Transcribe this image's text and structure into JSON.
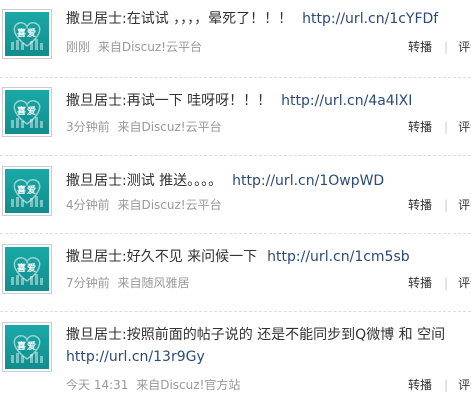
{
  "feed": {
    "posts": [
      {
        "avatar_text": "喜爱",
        "author": "撒旦居士:",
        "text": "在试试 ，，，，晕死了！！！",
        "link": "http://url.cn/1cYFDf",
        "time": "刚刚",
        "source": "来自Discuz!云平台",
        "repost_label": "转播",
        "comment_label": "评论"
      },
      {
        "avatar_text": "喜爱",
        "author": "撒旦居士:",
        "text": "再试一下 哇呀呀！！！",
        "link": "http://url.cn/4a4lXI",
        "time": "3分钟前",
        "source": "来自Discuz!云平台",
        "repost_label": "转播",
        "comment_label": "评论"
      },
      {
        "avatar_text": "喜爱",
        "author": "撒旦居士:",
        "text": "测试 推送。。。。",
        "link": "http://url.cn/1OwpWD",
        "time": "4分钟前",
        "source": "来自Discuz!云平台",
        "repost_label": "转播",
        "comment_label": "评论"
      },
      {
        "avatar_text": "喜爱",
        "author": "撒旦居士:",
        "text": "好久不见 来问候一下",
        "link": "http://url.cn/1cm5sb",
        "time": "7分钟前",
        "source": "来自随风雅居",
        "repost_label": "转播",
        "comment_label": "评论"
      },
      {
        "avatar_text": "喜爱",
        "author": "撒旦居士:",
        "text": "按照前面的帖子说的 还是不能同步到Q微博 和 空间",
        "link": "http://url.cn/13r9Gy",
        "time": "今天 14:31",
        "source": "来自Discuz!官方站",
        "repost_label": "转播",
        "comment_label": "评论"
      }
    ]
  },
  "icons": {
    "avatar": "brand-avatar-icon"
  },
  "colors": {
    "link": "#2b4a78",
    "meta": "#999999",
    "avatar_bg": "#1aa9a8"
  }
}
